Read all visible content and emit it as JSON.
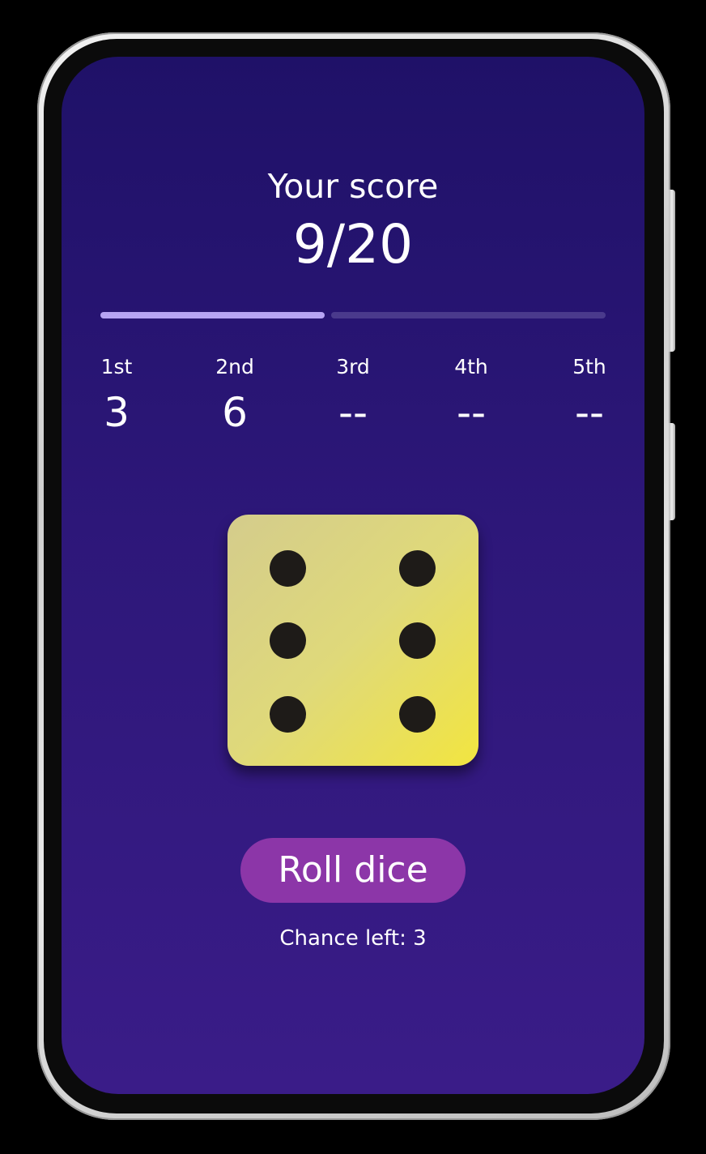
{
  "score": {
    "label": "Your score",
    "value": "9/20",
    "progress_fraction": 0.45
  },
  "rounds": [
    {
      "label": "1st",
      "value": "3"
    },
    {
      "label": "2nd",
      "value": "6"
    },
    {
      "label": "3rd",
      "value": "--"
    },
    {
      "label": "4th",
      "value": "--"
    },
    {
      "label": "5th",
      "value": "--"
    }
  ],
  "die": {
    "face_value": 6
  },
  "roll_button": {
    "label": "Roll dice"
  },
  "chance": {
    "text": "Chance left: 3"
  },
  "colors": {
    "background_top": "#1f1168",
    "background_bottom": "#3a1c88",
    "progress_fill": "#b7a4f4",
    "progress_track": "#4a3a8c",
    "die_face": "#e6dc5a",
    "die_pip": "#1e1b18",
    "button": "#8c36a8"
  },
  "icons": {
    "die": "dice-six-icon"
  }
}
